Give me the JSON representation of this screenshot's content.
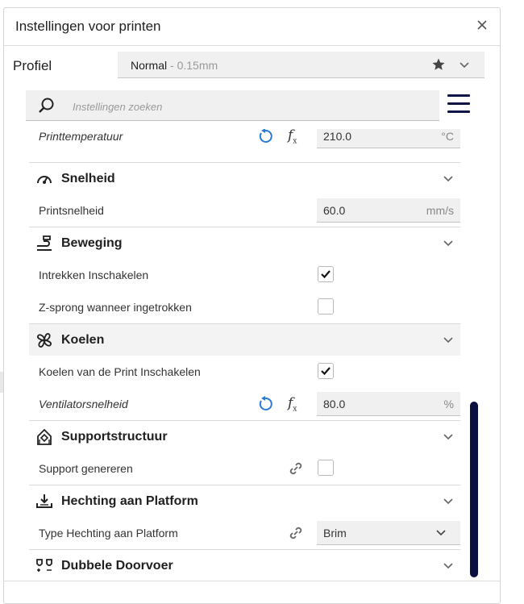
{
  "window": {
    "title": "Instellingen voor printen"
  },
  "profile": {
    "label": "Profiel",
    "name": "Normal",
    "sub": " - 0.15mm"
  },
  "search": {
    "placeholder": "Instellingen zoeken"
  },
  "rows": {
    "temp": {
      "label": "Printtemperatuur",
      "value": "210.0",
      "unit": "°C"
    },
    "speed_cat": {
      "label": "Snelheid"
    },
    "print_speed": {
      "label": "Printsnelheid",
      "value": "60.0",
      "unit": "mm/s"
    },
    "travel_cat": {
      "label": "Beweging"
    },
    "retraction": {
      "label": "Intrekken Inschakelen",
      "checked": true
    },
    "zhop": {
      "label": "Z-sprong wanneer ingetrokken",
      "checked": false
    },
    "cool_cat": {
      "label": "Koelen"
    },
    "cooling": {
      "label": "Koelen van de Print Inschakelen",
      "checked": true
    },
    "fan": {
      "label": "Ventilatorsnelheid",
      "value": "80.0",
      "unit": "%"
    },
    "support_cat": {
      "label": "Supportstructuur"
    },
    "support": {
      "label": "Support genereren",
      "checked": false
    },
    "adhesion_cat": {
      "label": "Hechting aan Platform"
    },
    "adhesion": {
      "label": "Type Hechting aan Platform",
      "value": "Brim"
    },
    "dual_cat": {
      "label": "Dubbele Doorvoer"
    }
  },
  "colors": {
    "accent": "#0a1040",
    "reset_blue": "#2a7ad6"
  }
}
